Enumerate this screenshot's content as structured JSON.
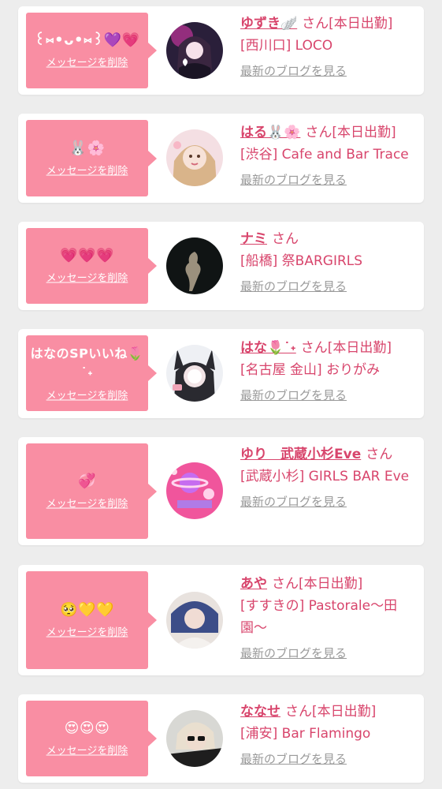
{
  "colors": {
    "background": "#ededed",
    "card": "#ffffff",
    "bubble": "#f98ea3",
    "accent_text": "#d8456c",
    "link_gray": "#9a9a9a"
  },
  "entries": [
    {
      "message": "꒰⑅•ᴗ•⑅꒱💜💗",
      "delete_label": "メッセージを削除",
      "avatar_icon": "girl-photo-neon-icon",
      "name": "ゆずき🪽",
      "san": "さん",
      "tag": "[本日出勤]",
      "shop": "[西川口] LOCO",
      "blog_label": "最新のブログを見る"
    },
    {
      "message": "🐰🌸",
      "delete_label": "メッセージを削除",
      "avatar_icon": "girl-photo-blonde-icon",
      "name": "はる🐰🌸",
      "san": "さん",
      "tag": "[本日出勤]",
      "shop": "[渋谷] Cafe and Bar Trace",
      "blog_label": "最新のブログを見る"
    },
    {
      "message": "💗💗💗",
      "delete_label": "メッセージを削除",
      "avatar_icon": "dark-photo-icon",
      "name": "ナミ",
      "san": "さん",
      "tag": "",
      "shop": "[船橋] 祭BARGIRLS",
      "blog_label": "最新のブログを見る"
    },
    {
      "message": "はなのSPいいね🌷˙˖",
      "delete_label": "メッセージを削除",
      "avatar_icon": "girl-photo-bunny-icon",
      "name": "はな🌷˙˖",
      "san": "さん",
      "tag": "[本日出勤]",
      "shop": "[名古屋 金山] おりがみ",
      "blog_label": "最新のブログを見る"
    },
    {
      "message": "💞",
      "delete_label": "メッセージを削除",
      "avatar_icon": "pink-graphic-photo-icon",
      "name": "ゆり　武蔵小杉Eve",
      "san": "さん",
      "tag": "",
      "shop": "[武蔵小杉] GIRLS BAR Eve",
      "blog_label": "最新のブログを見る"
    },
    {
      "message": "🥺💛💛",
      "delete_label": "メッセージを削除",
      "avatar_icon": "girl-photo-blue-hair-icon",
      "name": "あや",
      "san": "さん",
      "tag": "[本日出勤]",
      "shop": "[すすきの] Pastorale〜田園〜",
      "blog_label": "最新のブログを見る"
    },
    {
      "message": "😍😍😍",
      "delete_label": "メッセージを削除",
      "avatar_icon": "girl-photo-glasses-icon",
      "name": "ななせ",
      "san": "さん",
      "tag": "[本日出勤]",
      "shop": "[浦安] Bar Flamingo",
      "blog_label": "最新のブログを見る"
    }
  ]
}
